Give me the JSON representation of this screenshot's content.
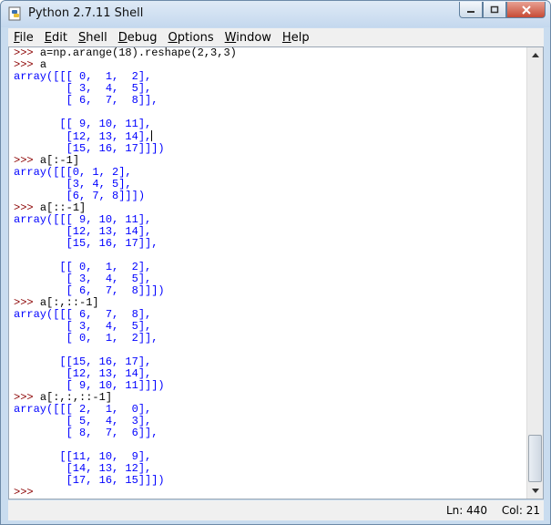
{
  "window": {
    "title": "Python 2.7.11 Shell",
    "icons": {
      "app": "python-idle-icon",
      "minimize": "minimize-icon",
      "maximize": "maximize-icon",
      "close": "close-icon"
    }
  },
  "menubar": {
    "items": [
      {
        "label": "File",
        "mnemonic": "F",
        "rest": "ile"
      },
      {
        "label": "Edit",
        "mnemonic": "E",
        "rest": "dit"
      },
      {
        "label": "Shell",
        "mnemonic": "S",
        "prefix": "",
        "rest": "hell"
      },
      {
        "label": "Debug",
        "mnemonic": "D",
        "rest": "ebug"
      },
      {
        "label": "Options",
        "mnemonic": "O",
        "rest": "ptions"
      },
      {
        "label": "Window",
        "mnemonic": "W",
        "rest": "indow"
      },
      {
        "label": "Help",
        "mnemonic": "H",
        "rest": "elp"
      }
    ]
  },
  "shell": {
    "prompt": ">>> ",
    "lines": [
      {
        "t": "in",
        "text": "a=np.arange(18).reshape(2,3,3)"
      },
      {
        "t": "in",
        "text": "a"
      },
      {
        "t": "out",
        "text": "array([[[ 0,  1,  2],"
      },
      {
        "t": "out",
        "text": "        [ 3,  4,  5],"
      },
      {
        "t": "out",
        "text": "        [ 6,  7,  8]],"
      },
      {
        "t": "out",
        "text": ""
      },
      {
        "t": "out",
        "text": "       [[ 9, 10, 11],"
      },
      {
        "t": "out",
        "text": "        [12, 13, 14],",
        "caret": true
      },
      {
        "t": "out",
        "text": "        [15, 16, 17]]])"
      },
      {
        "t": "in",
        "text": "a[:-1]"
      },
      {
        "t": "out",
        "text": "array([[[0, 1, 2],"
      },
      {
        "t": "out",
        "text": "        [3, 4, 5],"
      },
      {
        "t": "out",
        "text": "        [6, 7, 8]]])"
      },
      {
        "t": "in",
        "text": "a[::-1]"
      },
      {
        "t": "out",
        "text": "array([[[ 9, 10, 11],"
      },
      {
        "t": "out",
        "text": "        [12, 13, 14],"
      },
      {
        "t": "out",
        "text": "        [15, 16, 17]],"
      },
      {
        "t": "out",
        "text": ""
      },
      {
        "t": "out",
        "text": "       [[ 0,  1,  2],"
      },
      {
        "t": "out",
        "text": "        [ 3,  4,  5],"
      },
      {
        "t": "out",
        "text": "        [ 6,  7,  8]]])"
      },
      {
        "t": "in",
        "text": "a[:,::-1]"
      },
      {
        "t": "out",
        "text": "array([[[ 6,  7,  8],"
      },
      {
        "t": "out",
        "text": "        [ 3,  4,  5],"
      },
      {
        "t": "out",
        "text": "        [ 0,  1,  2]],"
      },
      {
        "t": "out",
        "text": ""
      },
      {
        "t": "out",
        "text": "       [[15, 16, 17],"
      },
      {
        "t": "out",
        "text": "        [12, 13, 14],"
      },
      {
        "t": "out",
        "text": "        [ 9, 10, 11]]])"
      },
      {
        "t": "in",
        "text": "a[:,:,::-1]"
      },
      {
        "t": "out",
        "text": "array([[[ 2,  1,  0],"
      },
      {
        "t": "out",
        "text": "        [ 5,  4,  3],"
      },
      {
        "t": "out",
        "text": "        [ 8,  7,  6]],"
      },
      {
        "t": "out",
        "text": ""
      },
      {
        "t": "out",
        "text": "       [[11, 10,  9],"
      },
      {
        "t": "out",
        "text": "        [14, 13, 12],"
      },
      {
        "t": "out",
        "text": "        [17, 16, 15]]])"
      },
      {
        "t": "in",
        "text": ""
      }
    ]
  },
  "scrollbar": {
    "up_icon": "scroll-up-arrow-icon",
    "down_icon": "scroll-down-arrow-icon"
  },
  "status": {
    "line": "Ln: 440",
    "col": "Col: 21"
  },
  "colors": {
    "prompt": "#8b0000",
    "output": "#0000ff",
    "input": "#000000"
  }
}
